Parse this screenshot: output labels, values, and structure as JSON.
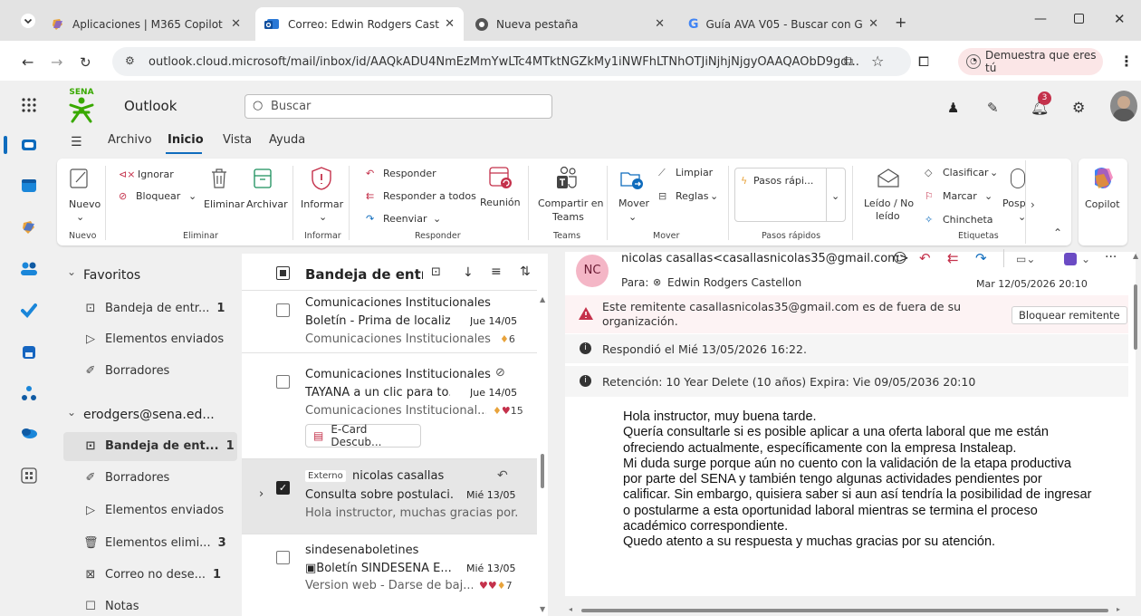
{
  "browser": {
    "tabs": [
      {
        "title": "Aplicaciones | M365 Copilot",
        "active": false
      },
      {
        "title": "Correo: Edwin Rodgers Castello",
        "active": true
      },
      {
        "title": "Nueva pestaña",
        "active": false
      },
      {
        "title": "Guía AVA V05 - Buscar con Goo",
        "active": false
      }
    ],
    "url": "outlook.cloud.microsoft/mail/inbox/id/AAQkADU4NmEzMmYwLTc4MTktNGZkMy1iNWFhLTNhOTJiNjhjNjgyOAAQAObD9gd...",
    "profile_label": "Demuestra que eres tú"
  },
  "app": {
    "logo": "SENA",
    "name": "Outlook",
    "search_placeholder": "Buscar",
    "notification_count": "3"
  },
  "menu": [
    "Archivo",
    "Inicio",
    "Vista",
    "Ayuda"
  ],
  "ribbon": {
    "nuevo": "Nuevo",
    "ignorar": "Ignorar",
    "bloquear": "Bloquear",
    "eliminar": "Eliminar",
    "archivar": "Archivar",
    "informar": "Informar",
    "responder": "Responder",
    "responder_todos": "Responder a todos",
    "reenviar": "Reenviar",
    "reunion": "Reunión",
    "compartir1": "Compartir en",
    "compartir2": "Teams",
    "mover": "Mover",
    "limpiar": "Limpiar",
    "reglas": "Reglas",
    "pasos": "Pasos rápi...",
    "leido1": "Leído / No",
    "leido2": "leído",
    "clasificar": "Clasificar",
    "marcar": "Marcar",
    "chincheta": "Chincheta",
    "pospo": "Posp",
    "copilot": "Copilot",
    "groups": {
      "nuevo": "Nuevo",
      "eliminar": "Eliminar",
      "informar": "Informar",
      "responder": "Responder",
      "teams": "Teams",
      "mover": "Mover",
      "pasos": "Pasos rápidos",
      "etiquetas": "Etiquetas"
    }
  },
  "folders": {
    "favoritos": "Favoritos",
    "fav_items": [
      {
        "label": "Bandeja de entr...",
        "count": "1"
      },
      {
        "label": "Elementos enviados",
        "count": ""
      },
      {
        "label": "Borradores",
        "count": ""
      }
    ],
    "account": "erodgers@sena.ed...",
    "acct_items": [
      {
        "label": "Bandeja de ent...",
        "count": "1"
      },
      {
        "label": "Borradores",
        "count": ""
      },
      {
        "label": "Elementos enviados",
        "count": ""
      },
      {
        "label": "Elementos elimi...",
        "count": "3"
      },
      {
        "label": "Correo no dese...",
        "count": "1"
      },
      {
        "label": "Notas",
        "count": ""
      }
    ]
  },
  "list": {
    "header": "Bandeja de entrad",
    "items": [
      {
        "sender": "Comunicaciones Institucionales",
        "subject": "Boletín - Prima de localiz...",
        "date": "Jue 14/05",
        "preview": "Comunicaciones Institucionales...",
        "reactions": "6"
      },
      {
        "sender": "Comunicaciones Institucionales",
        "subject": "TAYANA a un clic para to...",
        "date": "Jue 14/05",
        "preview": "Comunicaciones Institucional...",
        "reactions": "15",
        "attachment": "E-Card Descub..."
      },
      {
        "tag": "Externo",
        "sender": "nicolas casallas",
        "subject": "Consulta sobre postulaci...",
        "date": "Mié 13/05",
        "preview": "Hola instructor, muchas gracias por..."
      },
      {
        "sender": "sindesenaboletines",
        "subject": "Boletín SINDESENA E...",
        "date": "Mié 13/05",
        "preview": "Version web - Darse de baj...",
        "reactions": "7"
      }
    ]
  },
  "message": {
    "avatar": "NC",
    "from": "nicolas casallas<casallasnicolas35@gmail.com>",
    "to_label": "Para:",
    "to": "Edwin Rodgers Castellon",
    "date": "Mar 12/05/2026 20:10",
    "warning": "Este remitente casallasnicolas35@gmail.com es de fuera de su organización.",
    "block_button": "Bloquear remitente",
    "replied": "Respondió el Mié 13/05/2026 16:22.",
    "retention": "Retención: 10 Year Delete (10 años) Expira: Vie 09/05/2036 20:10",
    "body": [
      "Hola instructor, muy buena tarde.",
      "Quería consultarle si es posible aplicar a una oferta laboral que me están",
      "ofreciendo actualmente, específicamente con la empresa Instaleap.",
      "Mi duda surge porque aún no cuento con la validación de la etapa productiva",
      "por parte del SENA y también tengo algunas actividades pendientes por",
      "calificar. Sin embargo, quisiera saber si aun así tendría la posibilidad de ingresar",
      "o postularme a esta oportunidad laboral mientras se termina el proceso",
      "académico correspondiente.",
      "Quedo atento a su respuesta y muchas gracias por su atención."
    ]
  },
  "colors": {
    "accent": "#0f6cbd",
    "sena_green": "#39a900",
    "warning_bg": "#fdf3f4",
    "selected": "#e6e6e6"
  }
}
